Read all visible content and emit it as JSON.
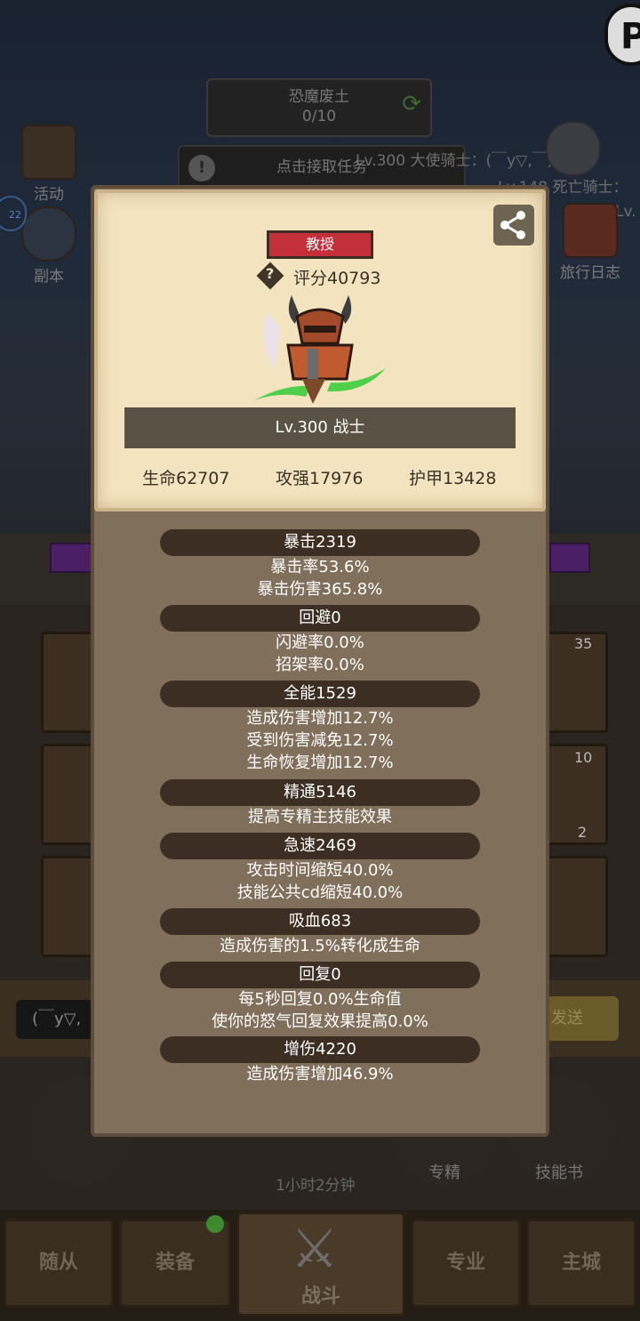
{
  "background": {
    "quest": {
      "name": "恐魔废土",
      "progress": "0/10",
      "accept": "点击接取任务"
    },
    "chat": [
      "Lv.300 大使骑士：(￣y▽,￣)",
      "Lv.148 死亡骑士：",
      "Lv."
    ],
    "left_icons": [
      {
        "label": "活动"
      },
      {
        "label": "副本"
      }
    ],
    "level_badge": "22",
    "right_icon": {
      "label": "旅行日志"
    },
    "slot_counts": [
      "35",
      "10",
      "2"
    ],
    "chat_input": "(￣y▽,",
    "send": "发送",
    "round_buttons": [
      "专精",
      "技能书"
    ],
    "timer": "1小时2分钟",
    "nav": {
      "followers": "随从",
      "equipment": "装备",
      "battle": "战斗",
      "profession": "专业",
      "main_city": "主城"
    }
  },
  "profile": {
    "title": "教授",
    "score": "评分40793",
    "class_line": "Lv.300 战士",
    "base_stats": [
      "生命62707",
      "攻强17976",
      "护甲13428"
    ]
  },
  "stats": [
    {
      "head": "暴击2319",
      "lines": [
        "暴击率53.6%",
        "暴击伤害365.8%"
      ]
    },
    {
      "head": "回避0",
      "lines": [
        "闪避率0.0%",
        "招架率0.0%"
      ]
    },
    {
      "head": "全能1529",
      "lines": [
        "造成伤害增加12.7%",
        "受到伤害减免12.7%",
        "生命恢复增加12.7%"
      ]
    },
    {
      "head": "精通5146",
      "lines": [
        "提高专精主技能效果"
      ]
    },
    {
      "head": "急速2469",
      "lines": [
        "攻击时间缩短40.0%",
        "技能公共cd缩短40.0%"
      ]
    },
    {
      "head": "吸血683",
      "lines": [
        "造成伤害的1.5%转化成生命"
      ]
    },
    {
      "head": "回复0",
      "lines": [
        "每5秒回复0.0%生命值",
        "使你的怒气回复效果提高0.0%"
      ]
    },
    {
      "head": "增伤4220",
      "lines": [
        "造成伤害增加46.9%"
      ]
    }
  ]
}
